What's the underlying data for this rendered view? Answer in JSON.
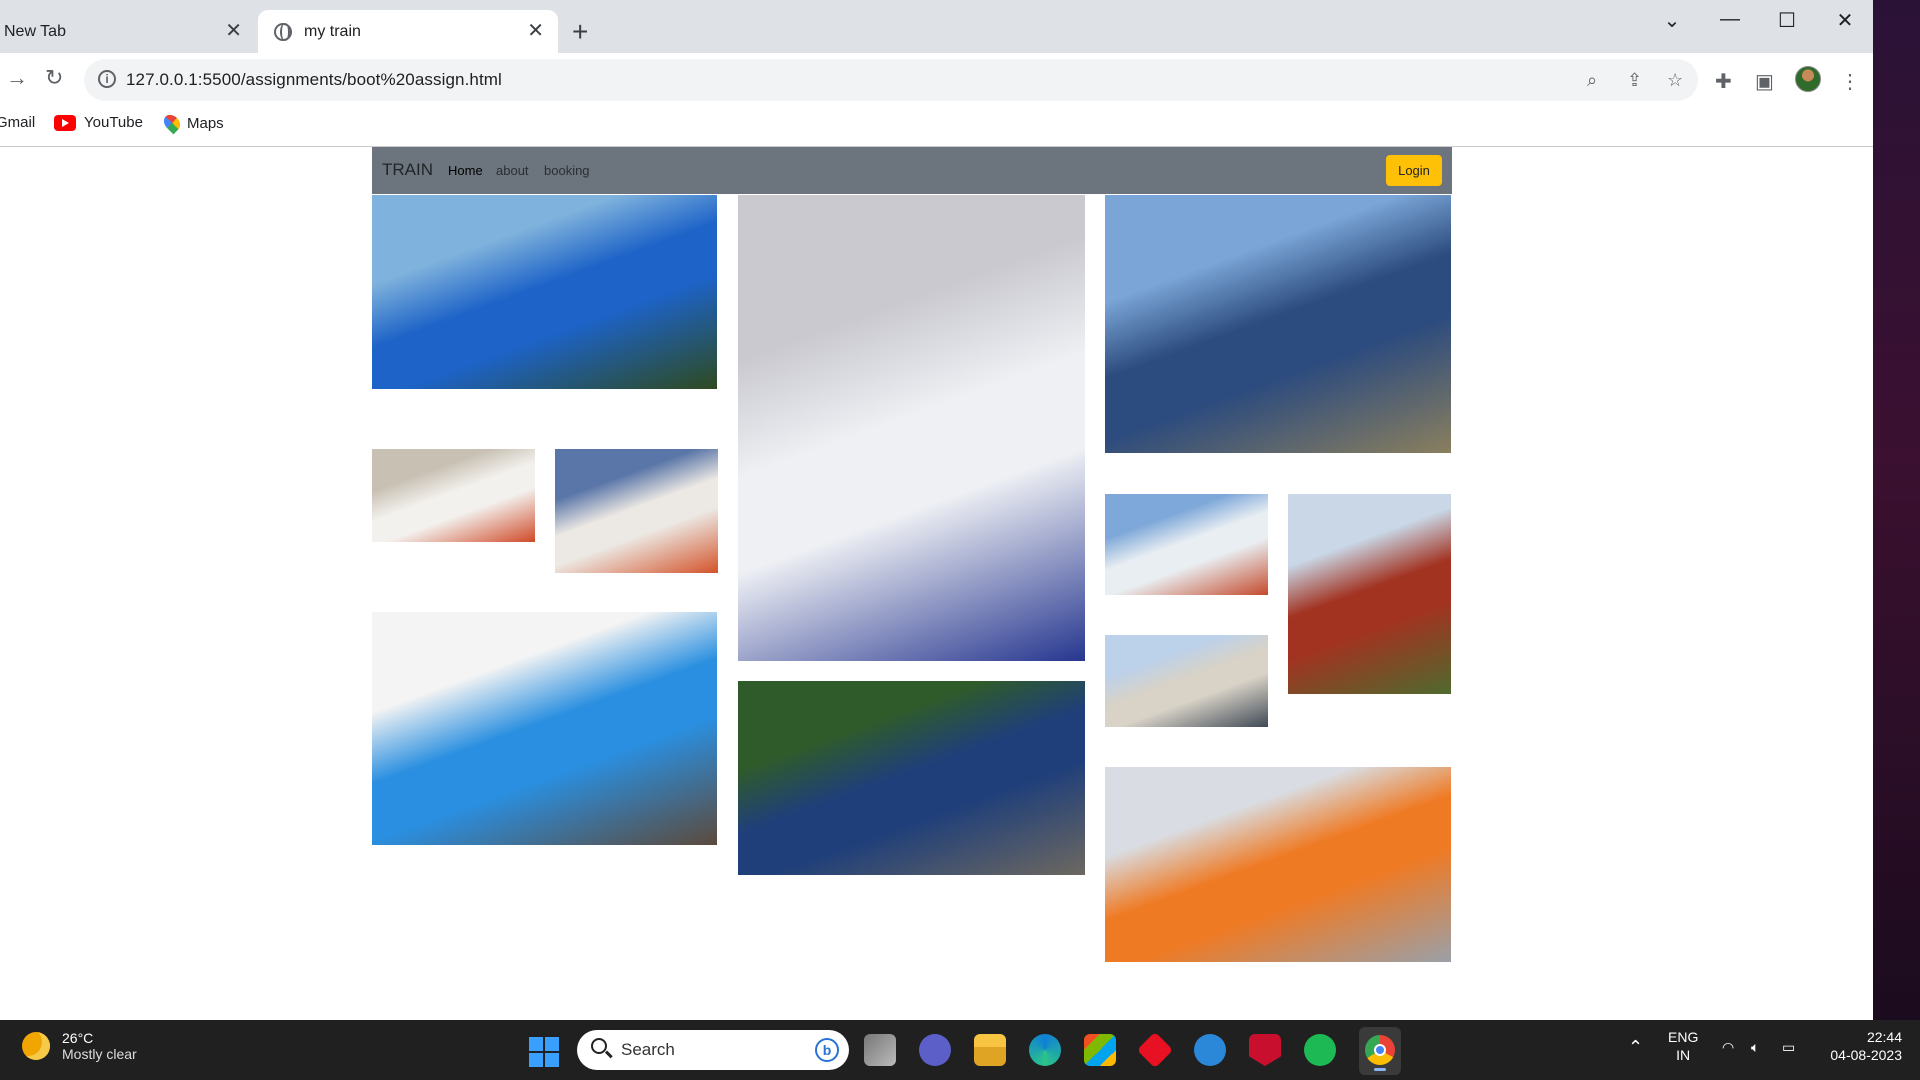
{
  "browser": {
    "tabs": [
      {
        "title": "New Tab",
        "active": false
      },
      {
        "title": "my train",
        "active": true
      }
    ],
    "url": "127.0.0.1:5500/assignments/boot%20assign.html",
    "bookmarks": [
      "Gmail",
      "YouTube",
      "Maps"
    ]
  },
  "site": {
    "brand": "TRAIN",
    "nav": [
      "Home",
      "about",
      "booking"
    ],
    "login_label": "Login",
    "navbar_color": "#6c757d",
    "login_color": "#ffc107"
  },
  "gallery": [
    {
      "name": "blue-electric-locomotive",
      "colors": [
        "#7fb2dc",
        "#1d63c8",
        "#2e4a1f"
      ]
    },
    {
      "name": "white-vande-bharat-front",
      "colors": [
        "#c9c9cf",
        "#eef0f4",
        "#26368f"
      ]
    },
    {
      "name": "highspeed-train-motion",
      "colors": [
        "#7aa5d6",
        "#2c4b7e",
        "#8a7f5e"
      ]
    },
    {
      "name": "white-red-locomotive-small",
      "colors": [
        "#c8c0b3",
        "#f3f1ee",
        "#cf4a27"
      ]
    },
    {
      "name": "white-orange-locomotive-small",
      "colors": [
        "#5a76a8",
        "#ece8e3",
        "#d3532a"
      ]
    },
    {
      "name": "freight-train-mountains",
      "colors": [
        "#7ea8d9",
        "#e9eef2",
        "#c44a2b"
      ]
    },
    {
      "name": "red-locomotive-catenary",
      "colors": [
        "#c9d7e6",
        "#a23321",
        "#4f6a2e"
      ]
    },
    {
      "name": "station-train-small",
      "colors": [
        "#bcd1ea",
        "#d8d2c7",
        "#3f4a55"
      ]
    },
    {
      "name": "blue-diesel-wdp4",
      "colors": [
        "#f4f4f4",
        "#2a8fe0",
        "#5c4a3c"
      ]
    },
    {
      "name": "toy-train-bridge",
      "colors": [
        "#2f5b2a",
        "#1f3f7a",
        "#6d6860"
      ]
    },
    {
      "name": "orange-vande-bharat",
      "colors": [
        "#d9dde3",
        "#ef7a24",
        "#9aa0a8"
      ]
    }
  ],
  "taskbar": {
    "weather_temp": "26°C",
    "weather_desc": "Mostly clear",
    "search_label": "Search",
    "lang_top": "ENG",
    "lang_bottom": "IN",
    "time": "22:44",
    "date": "04-08-2023"
  }
}
